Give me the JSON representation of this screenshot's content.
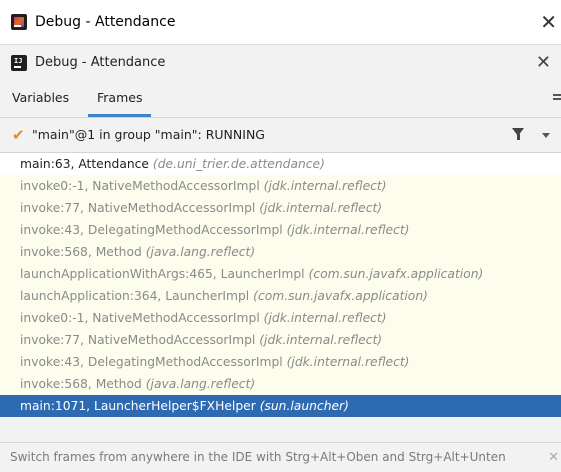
{
  "window": {
    "title": "Debug - Attendance",
    "close_glyph": "✕"
  },
  "toolwindow": {
    "title": "Debug - Attendance",
    "close_glyph": "✕"
  },
  "tabs": [
    {
      "label": "Variables",
      "active": false
    },
    {
      "label": "Frames",
      "active": true
    }
  ],
  "thread": {
    "check_glyph": "✔",
    "label": "\"main\"@1 in group \"main\": RUNNING"
  },
  "frames": [
    {
      "method": "main:63, Attendance",
      "pkg": "(de.uni_trier.de.attendance)"
    },
    {
      "method": "invoke0:-1, NativeMethodAccessorImpl",
      "pkg": "(jdk.internal.reflect)"
    },
    {
      "method": "invoke:77, NativeMethodAccessorImpl",
      "pkg": "(jdk.internal.reflect)"
    },
    {
      "method": "invoke:43, DelegatingMethodAccessorImpl",
      "pkg": "(jdk.internal.reflect)"
    },
    {
      "method": "invoke:568, Method",
      "pkg": "(java.lang.reflect)"
    },
    {
      "method": "launchApplicationWithArgs:465, LauncherImpl",
      "pkg": "(com.sun.javafx.application)"
    },
    {
      "method": "launchApplication:364, LauncherImpl",
      "pkg": "(com.sun.javafx.application)"
    },
    {
      "method": "invoke0:-1, NativeMethodAccessorImpl",
      "pkg": "(jdk.internal.reflect)"
    },
    {
      "method": "invoke:77, NativeMethodAccessorImpl",
      "pkg": "(jdk.internal.reflect)"
    },
    {
      "method": "invoke:43, DelegatingMethodAccessorImpl",
      "pkg": "(jdk.internal.reflect)"
    },
    {
      "method": "invoke:568, Method",
      "pkg": "(java.lang.reflect)"
    },
    {
      "method": "main:1071, LauncherHelper$FXHelper",
      "pkg": "(sun.launcher)"
    }
  ],
  "hint": {
    "text": "Switch frames from anywhere in the IDE with Strg+Alt+Oben and Strg+Alt+Unten",
    "close_glyph": "✕"
  },
  "colors": {
    "accent": "#4083c9",
    "selection": "#2e6ab2",
    "frame_bg": "#fdfdee",
    "check": "#e9872c"
  },
  "icons": [
    "intellij-logo-icon",
    "close-icon",
    "layout-icon",
    "checkmark-icon",
    "filter-icon",
    "chevron-down-icon"
  ]
}
